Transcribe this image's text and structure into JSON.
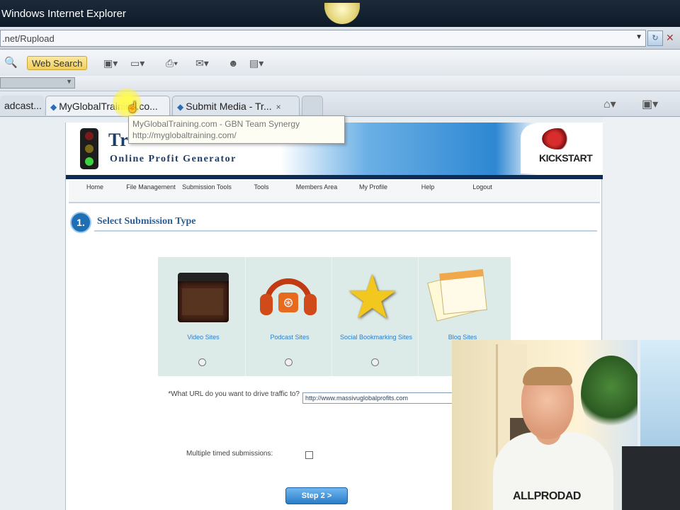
{
  "browser": {
    "title": "Windows Internet Explorer",
    "address": ".net/Rupload",
    "search_label": "Web Search",
    "tabs": [
      {
        "label": "adcast..."
      },
      {
        "label": "MyGlobalTraining.co..."
      },
      {
        "label": "Submit Media - Tr..."
      }
    ],
    "tooltip": {
      "line1": "MyGlobalTraining.com - GBN Team Synergy",
      "line2": "http://myglobaltraining.com/"
    }
  },
  "site": {
    "brand": "Tr",
    "tagline": "Online Profit Generator",
    "partner_logo": "KICKSTART",
    "nav": [
      {
        "label": "Home"
      },
      {
        "label": "File Management"
      },
      {
        "label": "Submission Tools"
      },
      {
        "label": "Tools"
      },
      {
        "label": "Members Area"
      },
      {
        "label": "My Profile"
      },
      {
        "label": "Help"
      },
      {
        "label": "Logout"
      }
    ],
    "step": {
      "number": "1.",
      "title": "Select Submission Type"
    },
    "options": [
      {
        "label": "Video Sites",
        "icon": "video-clapper-icon"
      },
      {
        "label": "Podcast Sites",
        "icon": "podcast-rss-icon"
      },
      {
        "label": "Social Bookmarking Sites",
        "icon": "star-icon"
      },
      {
        "label": "Blog Sites",
        "icon": "notepad-icon"
      }
    ],
    "url_question": "*What URL do you want to drive traffic to?",
    "url_value": "http://www.massivuglobalprofits.com",
    "multiple_label": "Multiple timed submissions:",
    "next_button": "Step 2 >"
  },
  "webcam": {
    "shirt_text": "ALLPRODAD"
  }
}
